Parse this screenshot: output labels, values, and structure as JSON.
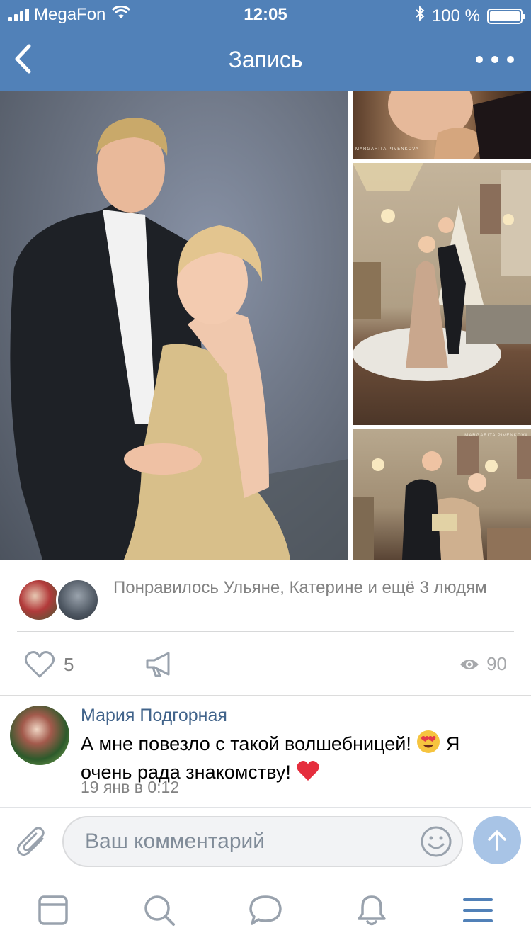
{
  "status_bar": {
    "carrier": "MegaFon",
    "time": "12:05",
    "battery_percent": "100 %",
    "battery_level": 1.0
  },
  "nav": {
    "title": "Запись"
  },
  "photos": {
    "watermark_1": "MARGARITA PIVENKOVA",
    "watermark_3": "MARGARITA PIVENKOVA"
  },
  "likes_summary": {
    "text": "Понравилось Ульяне, Катерине и ещё 3 людям"
  },
  "actions": {
    "like_count": "5",
    "view_count": "90"
  },
  "comment": {
    "author": "Мария Подгорная",
    "text_part1": "А мне повезло с такой волшебницей!",
    "text_part2": " Я очень рада знакомству!",
    "date": "19 янв в 0:12"
  },
  "comment_input": {
    "placeholder": "Ваш комментарий"
  },
  "colors": {
    "header": "#5181b8",
    "link": "#42648b",
    "secondary_text": "#828282",
    "tab_icon": "#99a2ad",
    "tab_active": "#5181b8",
    "send_button": "#a8c4e6"
  },
  "tab_bar": {
    "tabs": [
      "feed-icon",
      "search-icon",
      "messages-icon",
      "notifications-icon",
      "menu-icon"
    ],
    "active": "menu-icon"
  }
}
